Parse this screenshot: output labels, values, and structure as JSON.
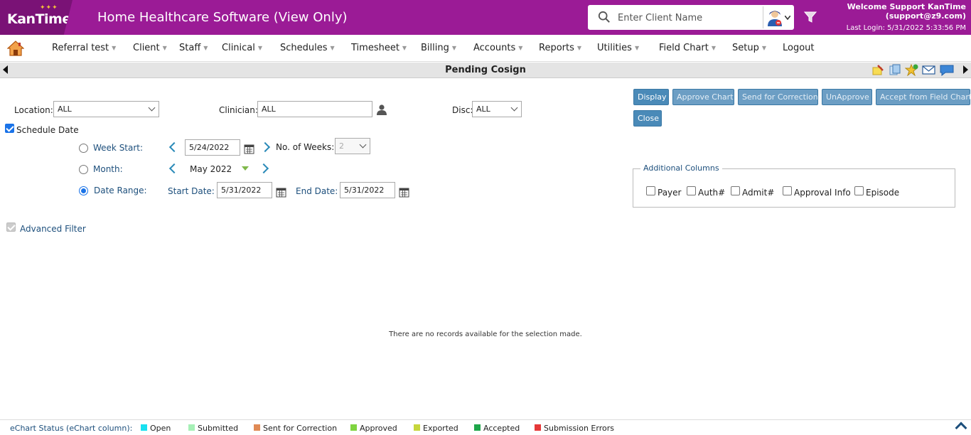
{
  "header": {
    "logo_text": "KanTime",
    "app_title": "Home Healthcare Software (View Only)",
    "search_placeholder": "Enter Client Name",
    "welcome_line1": "Welcome Support KanTime",
    "welcome_line2": "(support@z9.com)",
    "last_login": "Last Login: 5/31/2022 5:33:56 PM"
  },
  "nav": {
    "items": [
      {
        "label": "Referral test"
      },
      {
        "label": "Client"
      },
      {
        "label": "Staff"
      },
      {
        "label": "Clinical"
      },
      {
        "label": "Schedules"
      },
      {
        "label": "Timesheet"
      },
      {
        "label": "Billing"
      },
      {
        "label": "Accounts"
      },
      {
        "label": "Reports"
      },
      {
        "label": "Utilities"
      },
      {
        "label": "Field Chart"
      },
      {
        "label": "Setup"
      },
      {
        "label": "Logout"
      }
    ]
  },
  "titlebar": {
    "title": "Pending Cosign"
  },
  "form": {
    "location_label": "Location:",
    "location_value": "ALL",
    "clinician_label": "Clinician:",
    "clinician_value": "ALL",
    "disc_label": "Disc:",
    "disc_value": "ALL",
    "schedule_date_label": "Schedule Date",
    "schedule_date_checked": true,
    "week_start_label": "Week Start:",
    "week_start_value": "5/24/2022",
    "no_of_weeks_label": "No. of Weeks:",
    "no_of_weeks_value": "2",
    "month_label": "Month:",
    "month_value": "May 2022",
    "date_range_label": "Date Range:",
    "start_date_label": "Start Date:",
    "start_date_value": "5/31/2022",
    "end_date_label": "End Date:",
    "end_date_value": "5/31/2022",
    "advanced_filter_label": "Advanced Filter"
  },
  "buttons": {
    "display": "Display",
    "approve_chart": "Approve Chart",
    "send_for_correction": "Send for Correction",
    "unapprove": "UnApprove",
    "accept_from_field_chart": "Accept from Field Chart",
    "close": "Close"
  },
  "additional_columns": {
    "legend": "Additional Columns",
    "items": [
      {
        "label": "Payer"
      },
      {
        "label": "Auth#"
      },
      {
        "label": "Admit#"
      },
      {
        "label": "Approval Info"
      },
      {
        "label": "Episode"
      }
    ]
  },
  "results": {
    "empty_message": "There are no records available for the selection made."
  },
  "footer": {
    "label": "eChart Status (eChart column):",
    "statuses": [
      {
        "label": "Open",
        "color": "#19e0f0"
      },
      {
        "label": "Submitted",
        "color": "#a6f0b6"
      },
      {
        "label": "Sent for Correction",
        "color": "#e08a55"
      },
      {
        "label": "Approved",
        "color": "#7fd440"
      },
      {
        "label": "Exported",
        "color": "#c6d63c"
      },
      {
        "label": "Accepted",
        "color": "#1ea64a"
      },
      {
        "label": "Submission Errors",
        "color": "#e53838"
      }
    ]
  },
  "colors": {
    "header_bg": "#9b1b96",
    "button_bg": "#4a8ab8",
    "link_blue": "#1d4f7c"
  }
}
